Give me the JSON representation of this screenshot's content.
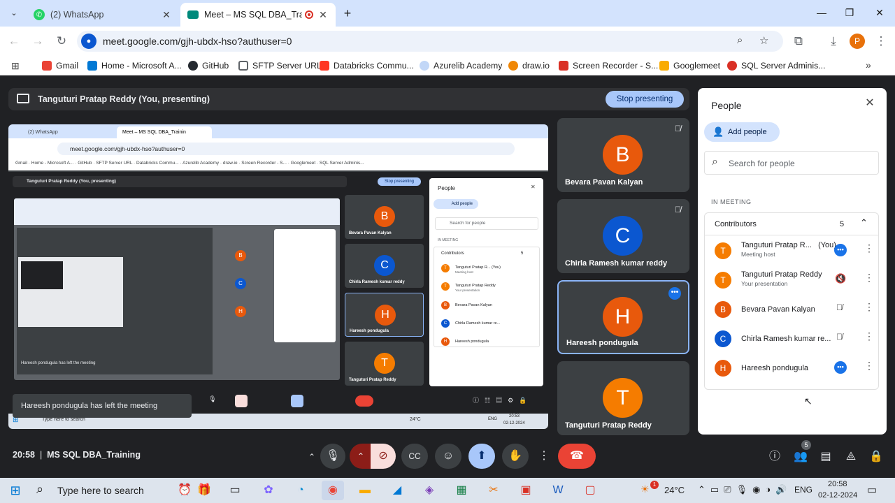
{
  "browser": {
    "tabs": [
      {
        "title": "(2) WhatsApp",
        "icon": "whatsapp-icon",
        "active": false
      },
      {
        "title": "Meet – MS SQL DBA_Training",
        "icon": "meet-icon",
        "active": true
      }
    ],
    "new_tab_symbol": "+",
    "url": "meet.google.com/gjh-ubdx-hso?authuser=0",
    "profile_initial": "P",
    "bookmarks": [
      {
        "label": "Gmail",
        "color": "#ea4335"
      },
      {
        "label": "Home - Microsoft A...",
        "color": "#0078d4"
      },
      {
        "label": "GitHub",
        "color": "#24292f"
      },
      {
        "label": "SFTP Server URL",
        "color": "#5f6368"
      },
      {
        "label": "Databricks Commu...",
        "color": "#ff3621"
      },
      {
        "label": "Azurelib Academy",
        "color": "#8ab4f8"
      },
      {
        "label": "draw.io",
        "color": "#f08705"
      },
      {
        "label": "Screen Recorder - S...",
        "color": "#d93025"
      },
      {
        "label": "Googlemeet",
        "color": "#f9ab00"
      },
      {
        "label": "SQL Server Adminis...",
        "color": "#d93025"
      }
    ]
  },
  "meet": {
    "presenting_title": "Tanguturi Pratap Reddy (You, presenting)",
    "stop_presenting_label": "Stop presenting",
    "tiles": [
      {
        "name": "Bevara Pavan Kalyan",
        "initial": "B",
        "color": "#e8590c",
        "muted": true
      },
      {
        "name": "Chirla Ramesh kumar reddy",
        "initial": "C",
        "color": "#0b57d0",
        "muted": true
      },
      {
        "name": "Hareesh pondugula",
        "initial": "H",
        "color": "#e8590c",
        "muted": false
      },
      {
        "name": "Tanguturi Pratap Reddy",
        "initial": "T",
        "color": "#f57c00",
        "muted": false
      }
    ],
    "toast": "Hareesh pondugula has left the meeting",
    "time": "20:58",
    "separator": "|",
    "meeting_name": "MS SQL DBA_Training",
    "people_badge_count": "5"
  },
  "people_panel": {
    "title": "People",
    "add_people_label": "Add people",
    "search_placeholder": "Search for people",
    "section_label": "IN MEETING",
    "group_label": "Contributors",
    "group_count": "5",
    "participants": [
      {
        "name": "Tanguturi Pratap R...",
        "suffix": "(You)",
        "sub": "Meeting host",
        "initial": "T",
        "color": "#f57c00",
        "status": "speaking"
      },
      {
        "name": "Tanguturi Pratap Reddy",
        "suffix": "",
        "sub": "Your presentation",
        "initial": "T",
        "color": "#f57c00",
        "status": "muted"
      },
      {
        "name": "Bevara Pavan Kalyan",
        "suffix": "",
        "sub": "",
        "initial": "B",
        "color": "#e8590c",
        "status": "muted"
      },
      {
        "name": "Chirla Ramesh kumar re...",
        "suffix": "",
        "sub": "",
        "initial": "C",
        "color": "#0b57d0",
        "status": "muted"
      },
      {
        "name": "Hareesh pondugula",
        "suffix": "",
        "sub": "",
        "initial": "H",
        "color": "#e8590c",
        "status": "speaking"
      }
    ]
  },
  "taskbar": {
    "search_placeholder": "Type here to search",
    "weather": "24°C",
    "language": "ENG",
    "clock_time": "20:58",
    "clock_date": "02-12-2024",
    "notification_count": "1"
  },
  "nested_capture": {
    "url": "meet.google.com/gjh-ubdx-hso?authuser=0",
    "presenting_title": "Tanguturi Pratap Reddy (You, presenting)",
    "stop_label": "Stop presenting",
    "tile_names": [
      "Bevara Pavan Kalyan",
      "Chirla Ramesh kumar reddy",
      "Hareesh pondugula",
      "Tanguturi Pratap Reddy"
    ],
    "people_title": "People",
    "add_people": "Add people",
    "search": "Search for people",
    "section": "IN MEETING",
    "group": "Contributors",
    "group_count": "5",
    "rows": [
      "Tanguturi Pratap R... (You)",
      "Tanguturi Pratap Reddy",
      "Bevara Pavan Kalyan",
      "Chirla Ramesh kumar re...",
      "Hareesh pondugula"
    ],
    "row_subs": [
      "Meeting host",
      "Your presentation"
    ],
    "toast": "Hareesh pondugula has left the meeting",
    "taskbar_search": "Type here to search",
    "weather": "24°C",
    "lang": "ENG",
    "time": "20:53",
    "date": "02-12-2024"
  }
}
